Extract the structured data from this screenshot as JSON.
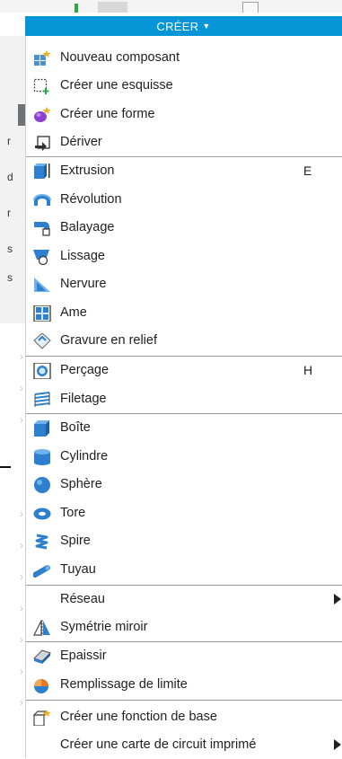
{
  "menu": {
    "title": "CRÉER",
    "items": [
      {
        "label": "Nouveau composant",
        "icon": "new-component-icon"
      },
      {
        "label": "Créer une esquisse",
        "icon": "sketch-icon"
      },
      {
        "label": "Créer une forme",
        "icon": "form-icon"
      },
      {
        "label": "Dériver",
        "icon": "derive-icon"
      },
      {
        "label": "Extrusion",
        "icon": "extrude-icon",
        "shortcut": "E"
      },
      {
        "label": "Révolution",
        "icon": "revolve-icon"
      },
      {
        "label": "Balayage",
        "icon": "sweep-icon"
      },
      {
        "label": "Lissage",
        "icon": "loft-icon"
      },
      {
        "label": "Nervure",
        "icon": "rib-icon"
      },
      {
        "label": "Ame",
        "icon": "web-icon"
      },
      {
        "label": "Gravure en relief",
        "icon": "emboss-icon"
      },
      {
        "label": "Perçage",
        "icon": "hole-icon",
        "shortcut": "H"
      },
      {
        "label": "Filetage",
        "icon": "thread-icon"
      },
      {
        "label": "Boîte",
        "icon": "box-icon"
      },
      {
        "label": "Cylindre",
        "icon": "cylinder-icon"
      },
      {
        "label": "Sphère",
        "icon": "sphere-icon"
      },
      {
        "label": "Tore",
        "icon": "torus-icon"
      },
      {
        "label": "Spire",
        "icon": "coil-icon"
      },
      {
        "label": "Tuyau",
        "icon": "pipe-icon"
      },
      {
        "label": "Réseau",
        "icon": "",
        "submenu": true
      },
      {
        "label": "Symétrie miroir",
        "icon": "mirror-icon"
      },
      {
        "label": "Epaissir",
        "icon": "thicken-icon"
      },
      {
        "label": "Remplissage de limite",
        "icon": "boundary-fill-icon"
      },
      {
        "label": "Créer une fonction de base",
        "icon": "base-feature-icon"
      },
      {
        "label": "Créer une carte de circuit imprimé",
        "icon": "",
        "submenu": true
      }
    ]
  },
  "background": {
    "left_fragments": [
      "r",
      "d",
      "r",
      "s",
      "s"
    ],
    "shortcut_keys": [
      "E",
      "H"
    ]
  },
  "colors": {
    "header_bg": "#0696d7",
    "header_text": "#ffffff",
    "icon_blue": "#3a8fd6",
    "text": "#1f1f1f"
  }
}
